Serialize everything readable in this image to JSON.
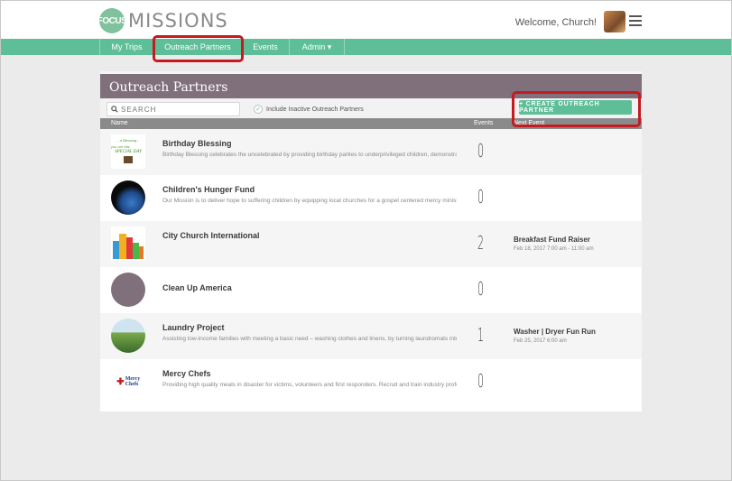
{
  "header": {
    "logo_badge": "FOCUS",
    "logo_text": "MISSIONS",
    "welcome": "Welcome, Church!",
    "menu_icon": "hamburger-icon"
  },
  "nav": {
    "items": [
      {
        "label": "My Trips"
      },
      {
        "label": "Outreach Partners"
      },
      {
        "label": "Events"
      },
      {
        "label": "Admin ▾"
      }
    ]
  },
  "panel": {
    "title": "Outreach Partners",
    "search_placeholder": "SEARCH",
    "include_inactive_label": "Include Inactive Outreach Partners",
    "create_button": "+ CREATE OUTREACH PARTNER",
    "columns": {
      "name": "Name",
      "events": "Events",
      "next_event": "Next Event"
    }
  },
  "partners": [
    {
      "name": "Birthday Blessing",
      "desc": "Birthday Blessing celebrates the uncelebrated by providing birthday parties to underprivileged children, demonstrati",
      "events": "0",
      "next_event": "",
      "next_date": ""
    },
    {
      "name": "Children's Hunger Fund",
      "desc": "Our Mission is to deliver hope to suffering children by equipping local churches for a gospel centered mercy minist",
      "events": "0",
      "next_event": "",
      "next_date": ""
    },
    {
      "name": "City Church International",
      "desc": "",
      "events": "2",
      "next_event": "Breakfast Fund Raiser",
      "next_date": "Feb 18, 2017 7:00 am - 11:00 am"
    },
    {
      "name": "Clean Up America",
      "desc": "",
      "events": "0",
      "next_event": "",
      "next_date": ""
    },
    {
      "name": "Laundry Project",
      "desc": "Assisting low-income families with meeting a basic need – washing clothes and linens, by turning laundromats into",
      "events": "1",
      "next_event": "Washer | Dryer Fun Run",
      "next_date": "Feb 25, 2017 6:00 am"
    },
    {
      "name": "Mercy Chefs",
      "desc": "Providing high quality meals in disaster for victims, volunteers and first responders. Recruit and train industry profe",
      "events": "0",
      "next_event": "",
      "next_date": ""
    }
  ],
  "thumb_texts": {
    "birthday": "...a Blessing...",
    "birthday2": "you are this",
    "birthday3": "SPECIAL DAY",
    "mercy": "Mercy Chefs"
  },
  "colors": {
    "accent": "#5ebe98",
    "panel_header": "#80707c",
    "highlight": "#c41a20"
  }
}
